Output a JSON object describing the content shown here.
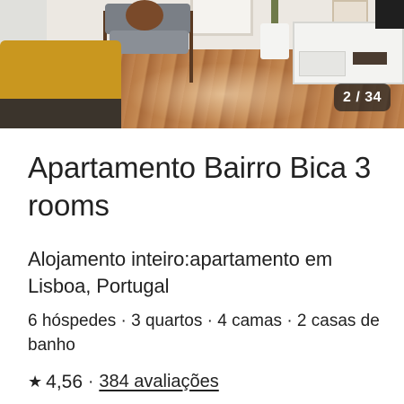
{
  "gallery": {
    "counter": "2 / 34"
  },
  "listing": {
    "title": "Apartamento Bairro Bica 3 rooms",
    "subtitle": "Alojamento inteiro:apartamento em Lisboa, Portugal",
    "details": "6 hóspedes · 3 quartos · 4 camas · 2 casas de banho",
    "rating": {
      "star_icon": "star-icon",
      "value": "4,56",
      "separator": "·",
      "reviews_label": "384 avaliações"
    }
  }
}
